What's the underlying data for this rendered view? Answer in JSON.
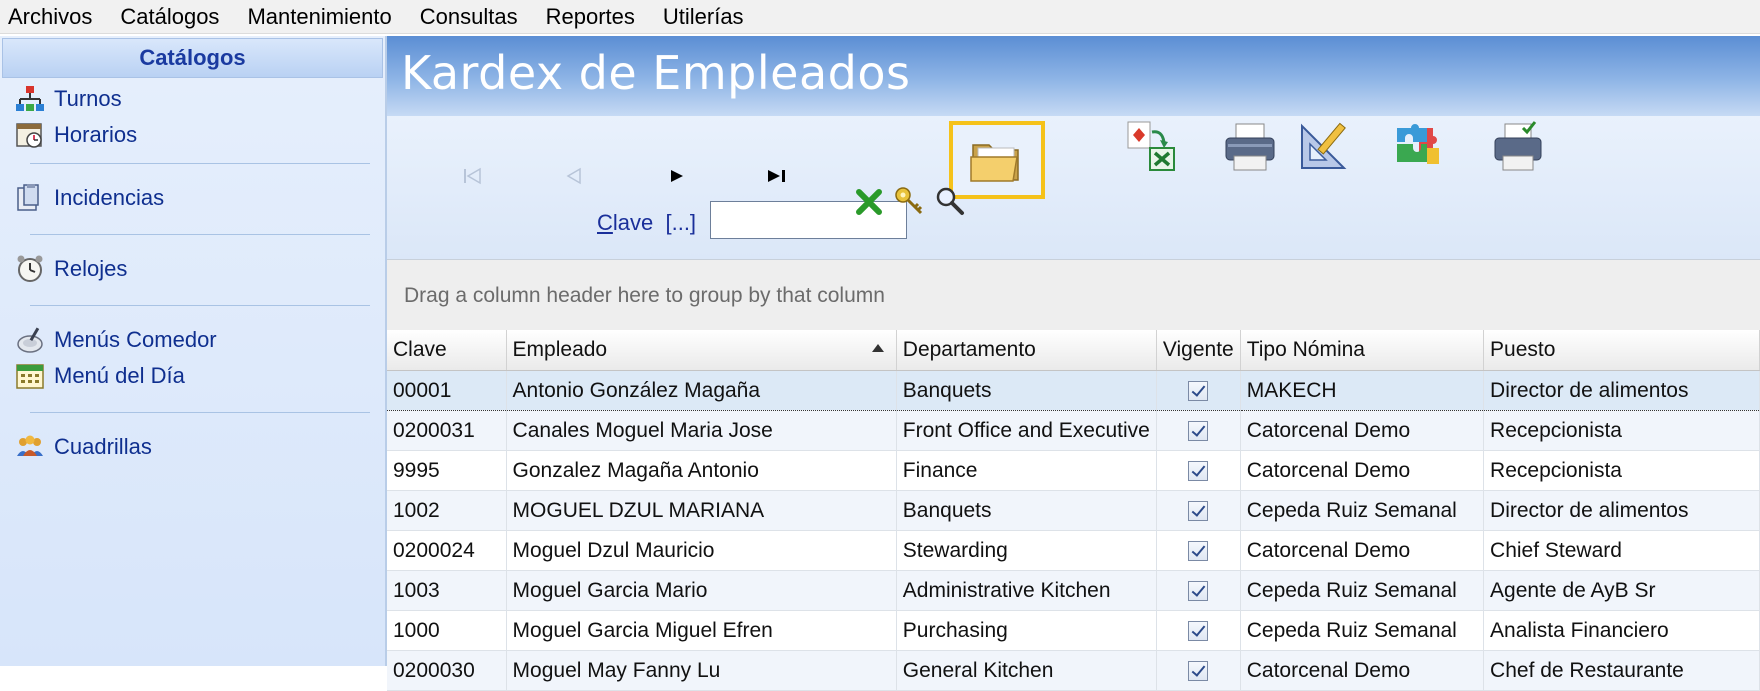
{
  "menu": [
    "Archivos",
    "Catálogos",
    "Mantenimiento",
    "Consultas",
    "Reportes",
    "Utilerías"
  ],
  "sidebar": {
    "header": "Catálogos",
    "items": [
      {
        "label": "Turnos",
        "icon": "org-chart-icon"
      },
      {
        "label": "Horarios",
        "icon": "calendar-clock-icon"
      },
      {
        "label": "Incidencias",
        "icon": "clipboard-icon"
      },
      {
        "label": "Relojes",
        "icon": "alarm-clock-icon"
      },
      {
        "label": "Menús Comedor",
        "icon": "dinner-plate-icon"
      },
      {
        "label": "Menú del Día",
        "icon": "calendar-icon"
      },
      {
        "label": "Cuadrillas",
        "icon": "people-group-icon"
      }
    ]
  },
  "main": {
    "title": "Kardex de Empleados",
    "clave_label_underlined": "C",
    "clave_label_rest": "lave",
    "clave_dots": "[...]",
    "clave_value": ""
  },
  "grid": {
    "group_hint": "Drag a column header here to group by that column",
    "columns": [
      "Clave",
      "Empleado",
      "Departamento",
      "Vigente",
      "Tipo Nómina",
      "Puesto"
    ],
    "rows": [
      {
        "clave": "00001",
        "empleado": "Antonio González Magaña",
        "departamento": "Banquets",
        "vigente": true,
        "tipo": "MAKECH",
        "puesto": "Director de alimentos"
      },
      {
        "clave": "0200031",
        "empleado": "Canales Moguel Maria Jose",
        "departamento": "Front Office and Executive",
        "vigente": true,
        "tipo": "Catorcenal Demo",
        "puesto": "Recepcionista"
      },
      {
        "clave": "9995",
        "empleado": "Gonzalez Magaña Antonio",
        "departamento": "Finance",
        "vigente": true,
        "tipo": "Catorcenal Demo",
        "puesto": "Recepcionista"
      },
      {
        "clave": "1002",
        "empleado": "MOGUEL DZUL MARIANA",
        "departamento": "Banquets",
        "vigente": true,
        "tipo": "Cepeda Ruiz Semanal",
        "puesto": "Director de alimentos"
      },
      {
        "clave": "0200024",
        "empleado": "Moguel Dzul Mauricio",
        "departamento": "Stewarding",
        "vigente": true,
        "tipo": "Catorcenal Demo",
        "puesto": "Chief Steward"
      },
      {
        "clave": "1003",
        "empleado": "Moguel Garcia Mario",
        "departamento": "Administrative Kitchen",
        "vigente": true,
        "tipo": "Cepeda Ruiz Semanal",
        "puesto": "Agente de AyB Sr"
      },
      {
        "clave": "1000",
        "empleado": "Moguel Garcia Miguel Efren",
        "departamento": "Purchasing",
        "vigente": true,
        "tipo": "Cepeda Ruiz Semanal",
        "puesto": "Analista Financiero"
      },
      {
        "clave": "0200030",
        "empleado": "Moguel May Fanny Lu",
        "departamento": "General Kitchen",
        "vigente": true,
        "tipo": "Catorcenal Demo",
        "puesto": "Chef de Restaurante"
      }
    ]
  }
}
